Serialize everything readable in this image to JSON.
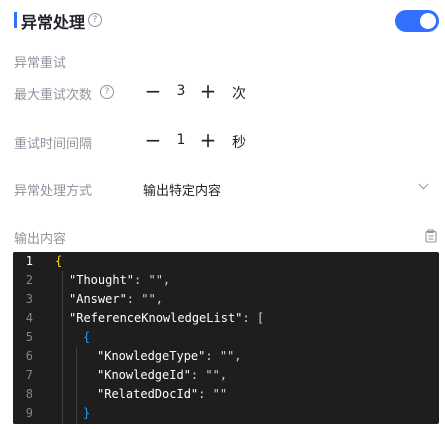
{
  "header": {
    "title": "异常处理",
    "help_icon": "question-circle-icon",
    "toggle_on": true,
    "accent": "#3370ff"
  },
  "retry": {
    "section_title": "异常重试",
    "max_retries_label": "最大重试次数",
    "max_retries_value": "3",
    "max_retries_unit": "次",
    "interval_label": "重试时间间隔",
    "interval_value": "1",
    "interval_unit": "秒",
    "minus": "−",
    "plus": "+"
  },
  "handling": {
    "label": "异常处理方式",
    "selected": "输出特定内容"
  },
  "output": {
    "label": "输出内容",
    "lines": [
      {
        "n": "1",
        "indent": 0,
        "text": "{"
      },
      {
        "n": "2",
        "indent": 1,
        "key": "\"Thought\"",
        "rest": ": \"\","
      },
      {
        "n": "3",
        "indent": 1,
        "key": "\"Answer\"",
        "rest": ": \"\","
      },
      {
        "n": "4",
        "indent": 1,
        "key": "\"ReferenceKnowledgeList\"",
        "rest": ": ["
      },
      {
        "n": "5",
        "indent": 2,
        "text": "{"
      },
      {
        "n": "6",
        "indent": 3,
        "key": "\"KnowledgeType\"",
        "rest": ": \"\","
      },
      {
        "n": "7",
        "indent": 3,
        "key": "\"KnowledgeId\"",
        "rest": ": \"\","
      },
      {
        "n": "8",
        "indent": 3,
        "key": "\"RelatedDocId\"",
        "rest": ": \"\""
      },
      {
        "n": "9",
        "indent": 2,
        "text": "}"
      }
    ]
  }
}
